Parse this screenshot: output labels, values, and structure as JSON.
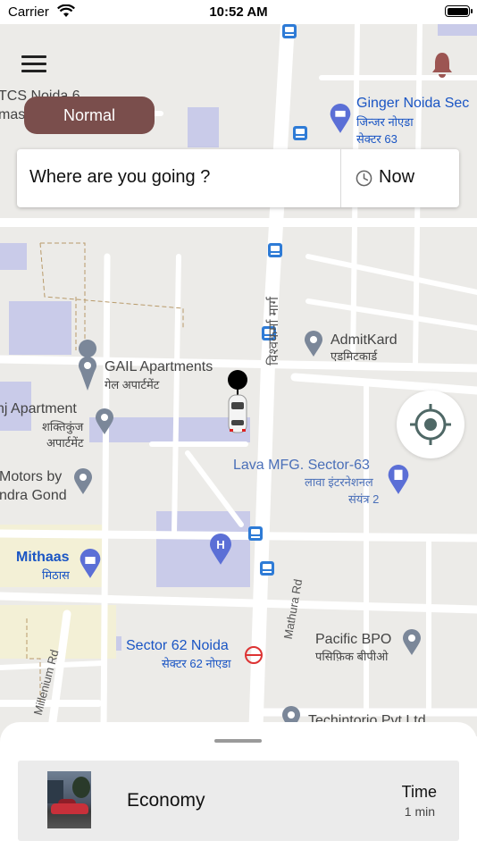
{
  "status": {
    "carrier": "Carrier",
    "time": "10:52 AM"
  },
  "header": {
    "mode_label": "Normal"
  },
  "search": {
    "destination_prompt": "Where are you going ?",
    "time_option": "Now"
  },
  "map": {
    "labels": {
      "tcs_line1": "TCS Noida 6",
      "tcs_line2": "mas",
      "ginger_en": "Ginger Noida Sec",
      "ginger_hi_1": "जिन्जर नोएडा",
      "ginger_hi_2": "सेक्टर 63",
      "gail_en": "GAIL Apartments",
      "gail_hi": "गेल अपार्टमेंट",
      "nj_en": "nj Apartment",
      "nj_hi_1": "शक्तिकुंज",
      "nj_hi_2": "अपार्टमेंट",
      "vishwakarma": "विश्वकर्मा मार्ग",
      "admit_en": "AdmitKard",
      "admit_hi": "एडमिटकार्ड",
      "lava_en": "Lava MFG. Sector-63",
      "lava_hi_1": "लावा इंटरनेशनल",
      "lava_hi_2": "संयंत्र 2",
      "motors_1": "Motors by",
      "motors_2": "ndra Gond",
      "mithaas_en": "Mithaas",
      "mithaas_hi": "मिठास",
      "mathura_rd": "Mathura Rd",
      "millenium_rd": "Millenium Rd",
      "sector62_en": "Sector 62 Noida",
      "sector62_hi": "सेक्टर 62 नोएडा",
      "pacific_en": "Pacific BPO",
      "pacific_hi": "पसिफ़िक बीपीओ",
      "techintorio": "Techintorio Pvt Ltd"
    }
  },
  "ride": {
    "name": "Economy",
    "time_label": "Time",
    "time_value": "1 min"
  },
  "colors": {
    "mode_pill": "#7a4e4c",
    "map_background": "#ecebe8",
    "road": "#ffffff",
    "poi_blue": "#1a55c4",
    "building": "#c9cbe9"
  },
  "icons": [
    "wifi-icon",
    "battery-icon",
    "menu-icon",
    "bell-icon",
    "clock-icon",
    "locate-icon",
    "map-pin-icon",
    "bus-stop-icon",
    "hotel-icon",
    "hospital-icon",
    "shopping-icon",
    "metro-icon",
    "car-icon"
  ]
}
